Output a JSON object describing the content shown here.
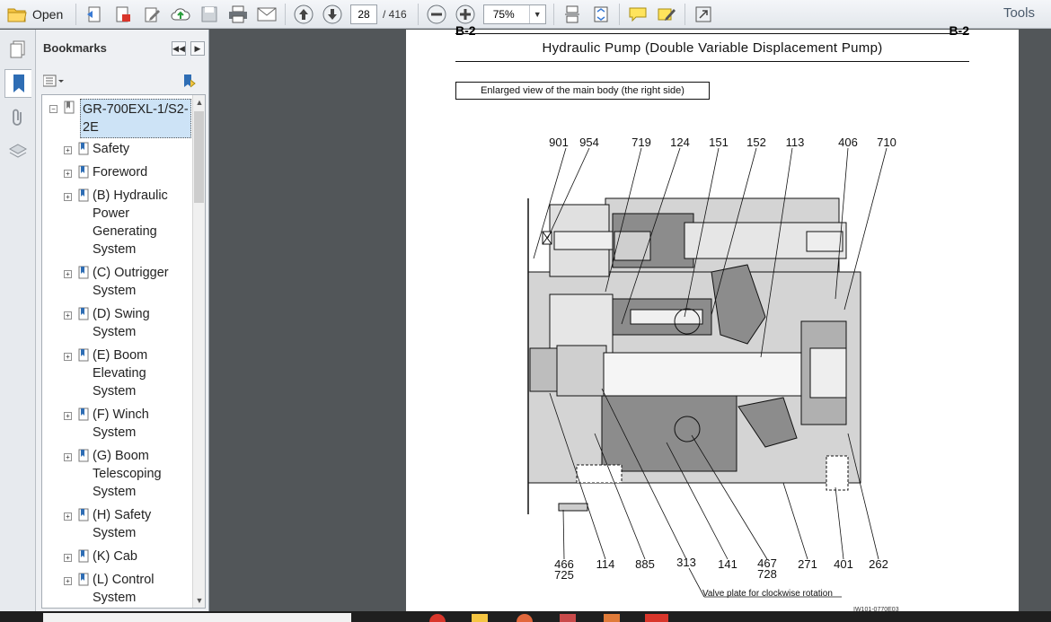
{
  "toolbar": {
    "open_label": "Open",
    "current_page": "28",
    "total_pages": "/ 416",
    "zoom": "75%",
    "tools_label": "Tools"
  },
  "panel": {
    "title": "Bookmarks",
    "bookmarks": [
      {
        "lines": [
          "GR-700EXL-1/S2-",
          "2E"
        ],
        "toggle": "−"
      },
      {
        "lines": [
          "Safety"
        ],
        "toggle": "+"
      },
      {
        "lines": [
          "Foreword"
        ],
        "toggle": "+"
      },
      {
        "lines": [
          "(B) Hydraulic",
          "Power",
          "Generating",
          "System"
        ],
        "toggle": "+"
      },
      {
        "lines": [
          "(C) Outrigger",
          "System"
        ],
        "toggle": "+"
      },
      {
        "lines": [
          "(D) Swing",
          "System"
        ],
        "toggle": "+"
      },
      {
        "lines": [
          "(E) Boom",
          "Elevating",
          "System"
        ],
        "toggle": "+"
      },
      {
        "lines": [
          "(F) Winch",
          "System"
        ],
        "toggle": "+"
      },
      {
        "lines": [
          "(G) Boom",
          "Telescoping",
          "System"
        ],
        "toggle": "+"
      },
      {
        "lines": [
          "(H) Safety",
          "System"
        ],
        "toggle": "+"
      },
      {
        "lines": [
          "(K) Cab"
        ],
        "toggle": "+"
      },
      {
        "lines": [
          "(L) Control",
          "System"
        ],
        "toggle": "+"
      }
    ]
  },
  "document": {
    "corner_left": "B-2",
    "corner_right": "B-2",
    "title": "Hydraulic Pump (Double Variable Displacement Pump)",
    "caption": "Enlarged view of the main body (the right side)",
    "top_labels": [
      "901",
      "954",
      "719",
      "124",
      "151",
      "152",
      "113",
      "406",
      "710"
    ],
    "bottom_labels": [
      "466",
      "114",
      "885",
      "313",
      "141",
      "467",
      "271",
      "401",
      "262"
    ],
    "bottom_labels_second": [
      "725",
      "728"
    ],
    "valve_note": "Valve plate for clockwise rotation",
    "code": "IW101-0770E03"
  },
  "colors": {
    "toolbar_bg": "#e8ebef",
    "doc_bg": "#525659",
    "selection": "#cde3f6",
    "accent": "#2e6db4"
  }
}
